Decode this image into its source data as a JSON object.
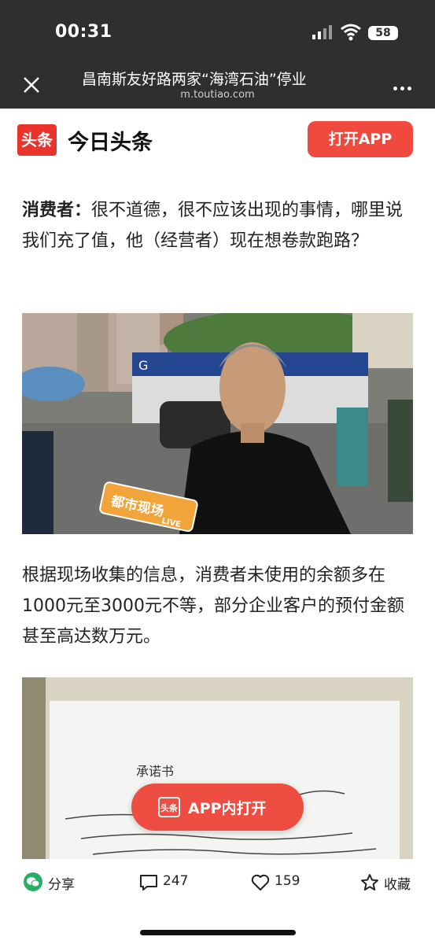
{
  "status_bar": {
    "time": "00:31",
    "battery": "58"
  },
  "nav": {
    "title": "昌南斯友好路两家“海湾石油”停业",
    "url": "m.toutiao.com"
  },
  "app_bar": {
    "logo_text": "头条",
    "brand": "今日头条",
    "open_app_label": "打开APP"
  },
  "article": {
    "para1_speaker": "消费者：",
    "para1_text": "很不道德，很不应该出现的事情，哪里说我们充了值，他（经营者）现在想卷款跑路？",
    "photo1_caption_badge": "都市现场",
    "photo1_live": "LIVE",
    "photo1_sign": "G",
    "para2_text": "根据现场收集的信息，消费者未使用的余额多在1000元至3000元不等，部分企业客户的预付金额甚至高达数万元。",
    "photo2_heading": "承诺书"
  },
  "float_button": {
    "logo_text": "头条",
    "label": "APP内打开"
  },
  "bottom_bar": {
    "share_label": "分享",
    "comments_count": "247",
    "likes_count": "159",
    "favorite_label": "收藏"
  },
  "colors": {
    "brand_red": "#e8342a",
    "button_red": "#f04a3f",
    "wechat_green": "#2aae67"
  },
  "icons": [
    "close-icon",
    "more-icon",
    "wechat-icon",
    "comment-icon",
    "heart-icon",
    "star-icon"
  ]
}
